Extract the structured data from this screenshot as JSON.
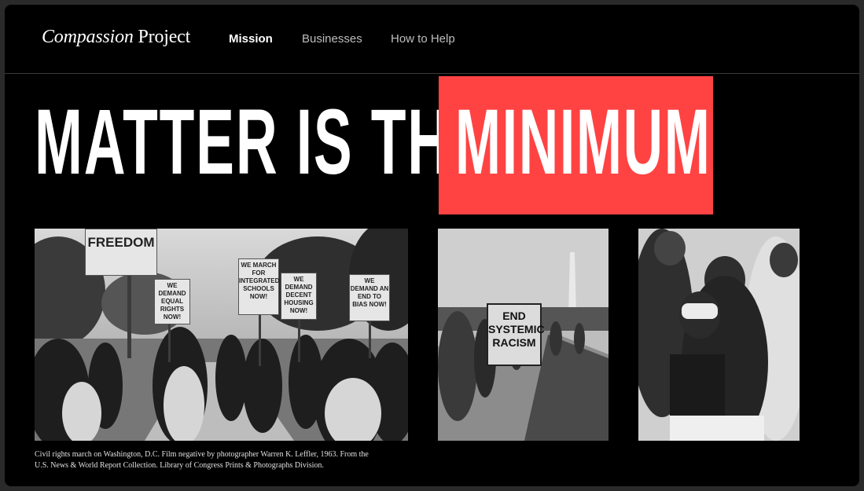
{
  "brand": {
    "logo_italic": "Compassion",
    "logo_regular": "Project"
  },
  "nav": {
    "items": [
      {
        "label": "Mission",
        "active": true
      },
      {
        "label": "Businesses",
        "active": false
      },
      {
        "label": "How to Help",
        "active": false
      }
    ]
  },
  "hero": {
    "headline_white": "MATTER IS THE",
    "headline_highlight": "MINIMUM",
    "highlight_color": "#ff4343"
  },
  "photos": {
    "march_signs": [
      "FREEDOM",
      "WE DEMAND EQUAL RIGHTS NOW!",
      "WE MARCH FOR INTEGRATED SCHOOLS NOW!",
      "WE DEMAND DECENT HOUSING NOW!",
      "WE DEMAND AN END TO BIAS NOW!"
    ],
    "protest_sign": "END SYSTEMIC RACISM"
  },
  "caption": "Civil rights march on Washington, D.C. Film negative by photographer Warren K. Leffler, 1963. From the U.S. News & World Report Collection. Library of Congress Prints & Photographs Division."
}
